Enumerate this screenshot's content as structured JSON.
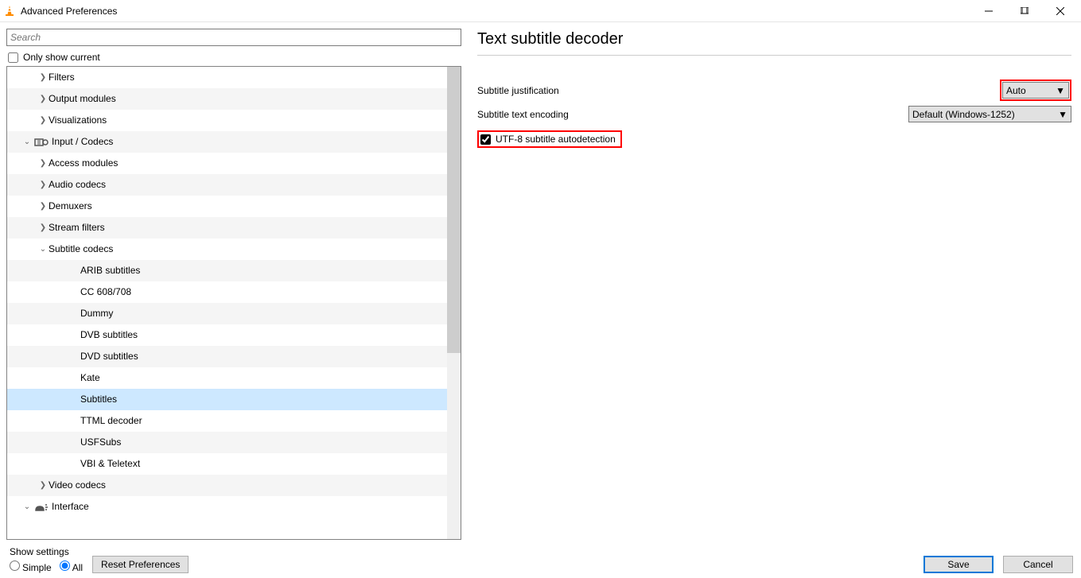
{
  "window": {
    "title": "Advanced Preferences"
  },
  "search": {
    "placeholder": "Search"
  },
  "only_current": {
    "label": "Only show current"
  },
  "tree": [
    {
      "label": "Filters",
      "indent": 1,
      "arrow": ">",
      "alt": false
    },
    {
      "label": "Output modules",
      "indent": 1,
      "arrow": ">",
      "alt": true
    },
    {
      "label": "Visualizations",
      "indent": 1,
      "arrow": ">",
      "alt": false
    },
    {
      "label": "Input / Codecs",
      "indent": 0,
      "arrow": "v",
      "alt": true,
      "icon": "input"
    },
    {
      "label": "Access modules",
      "indent": 1,
      "arrow": ">",
      "alt": false
    },
    {
      "label": "Audio codecs",
      "indent": 1,
      "arrow": ">",
      "alt": true
    },
    {
      "label": "Demuxers",
      "indent": 1,
      "arrow": ">",
      "alt": false
    },
    {
      "label": "Stream filters",
      "indent": 1,
      "arrow": ">",
      "alt": true
    },
    {
      "label": "Subtitle codecs",
      "indent": 1,
      "arrow": "v",
      "alt": false
    },
    {
      "label": "ARIB subtitles",
      "indent": 3,
      "arrow": "",
      "alt": true
    },
    {
      "label": "CC 608/708",
      "indent": 3,
      "arrow": "",
      "alt": false
    },
    {
      "label": "Dummy",
      "indent": 3,
      "arrow": "",
      "alt": true
    },
    {
      "label": "DVB subtitles",
      "indent": 3,
      "arrow": "",
      "alt": false
    },
    {
      "label": "DVD subtitles",
      "indent": 3,
      "arrow": "",
      "alt": true
    },
    {
      "label": "Kate",
      "indent": 3,
      "arrow": "",
      "alt": false
    },
    {
      "label": "Subtitles",
      "indent": 3,
      "arrow": "",
      "alt": true,
      "selected": true
    },
    {
      "label": "TTML decoder",
      "indent": 3,
      "arrow": "",
      "alt": false
    },
    {
      "label": "USFSubs",
      "indent": 3,
      "arrow": "",
      "alt": true
    },
    {
      "label": "VBI & Teletext",
      "indent": 3,
      "arrow": "",
      "alt": false
    },
    {
      "label": "Video codecs",
      "indent": 1,
      "arrow": ">",
      "alt": true
    },
    {
      "label": "Interface",
      "indent": 0,
      "arrow": "v",
      "alt": false,
      "icon": "interface"
    }
  ],
  "panel": {
    "title": "Text subtitle decoder",
    "justification_label": "Subtitle justification",
    "justification_value": "Auto",
    "encoding_label": "Subtitle text encoding",
    "encoding_value": "Default (Windows-1252)",
    "utf8_label": "UTF-8 subtitle autodetection"
  },
  "footer": {
    "show_settings_label": "Show settings",
    "simple": "Simple",
    "all": "All",
    "reset": "Reset Preferences",
    "save": "Save",
    "cancel": "Cancel"
  }
}
